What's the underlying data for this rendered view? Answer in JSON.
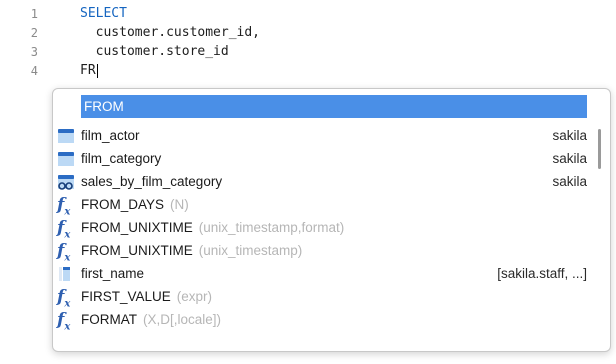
{
  "editor": {
    "lines": [
      {
        "num": "1",
        "kw": "SELECT",
        "text": ""
      },
      {
        "num": "2",
        "kw": "",
        "text": "  customer.customer_id,"
      },
      {
        "num": "3",
        "kw": "",
        "text": "  customer.store_id"
      },
      {
        "num": "4",
        "kw": "",
        "text": "FR"
      }
    ]
  },
  "autocomplete": {
    "items": [
      {
        "label": "FROM",
        "hint": "",
        "source": "",
        "icon": "keyword-icon"
      },
      {
        "label": "film_actor",
        "hint": "",
        "source": "sakila",
        "icon": "table-icon"
      },
      {
        "label": "film_category",
        "hint": "",
        "source": "sakila",
        "icon": "table-icon"
      },
      {
        "label": "sales_by_film_category",
        "hint": "",
        "source": "sakila",
        "icon": "view-icon"
      },
      {
        "label": "FROM_DAYS",
        "hint": "(N)",
        "source": "",
        "icon": "function-icon"
      },
      {
        "label": "FROM_UNIXTIME",
        "hint": "(unix_timestamp,format)",
        "source": "",
        "icon": "function-icon"
      },
      {
        "label": "FROM_UNIXTIME",
        "hint": "(unix_timestamp)",
        "source": "",
        "icon": "function-icon"
      },
      {
        "label": "first_name",
        "hint": "",
        "source": "[sakila.staff, ...]",
        "icon": "column-icon"
      },
      {
        "label": "FIRST_VALUE",
        "hint": "(expr)",
        "source": "",
        "icon": "function-icon"
      },
      {
        "label": "FORMAT",
        "hint": "(X,D[,locale])",
        "source": "",
        "icon": "function-icon"
      }
    ]
  },
  "colors": {
    "keyword": "#1565c0",
    "selection": "#4a8fe7",
    "hint": "#b6b6b6",
    "function_icon": "#2e5fb0"
  }
}
